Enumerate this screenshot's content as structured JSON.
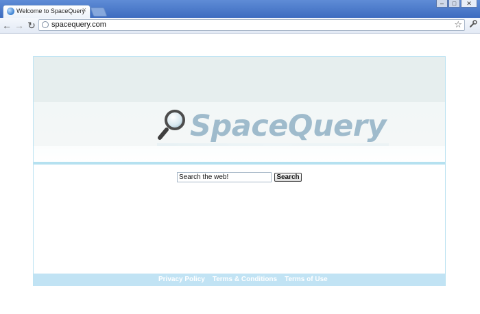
{
  "browser": {
    "tab": {
      "title": "Welcome to SpaceQuery",
      "close_glyph": "×",
      "favicon": "globe-icon"
    },
    "window_buttons": [
      {
        "name": "minimize",
        "glyph": "–"
      },
      {
        "name": "maximize",
        "glyph": "□"
      },
      {
        "name": "close",
        "glyph": "✕"
      }
    ],
    "nav": {
      "back": "←",
      "forward": "→",
      "reload": "↻"
    },
    "address": {
      "url": "spacequery.com"
    },
    "star_glyph": "☆",
    "wrench_glyph": "🔧"
  },
  "page": {
    "logo": {
      "text": "SpaceQuery",
      "icon": "magnifier-icon",
      "color": "#9fbbcc"
    },
    "search": {
      "placeholder": "",
      "value": "Search the web!",
      "button_label": "Search"
    },
    "footer": {
      "links": [
        "Privacy Policy",
        "Terms & Conditions",
        "Terms of Use"
      ],
      "background": "#c1e3f4"
    },
    "accent": "#b5e1f0"
  }
}
